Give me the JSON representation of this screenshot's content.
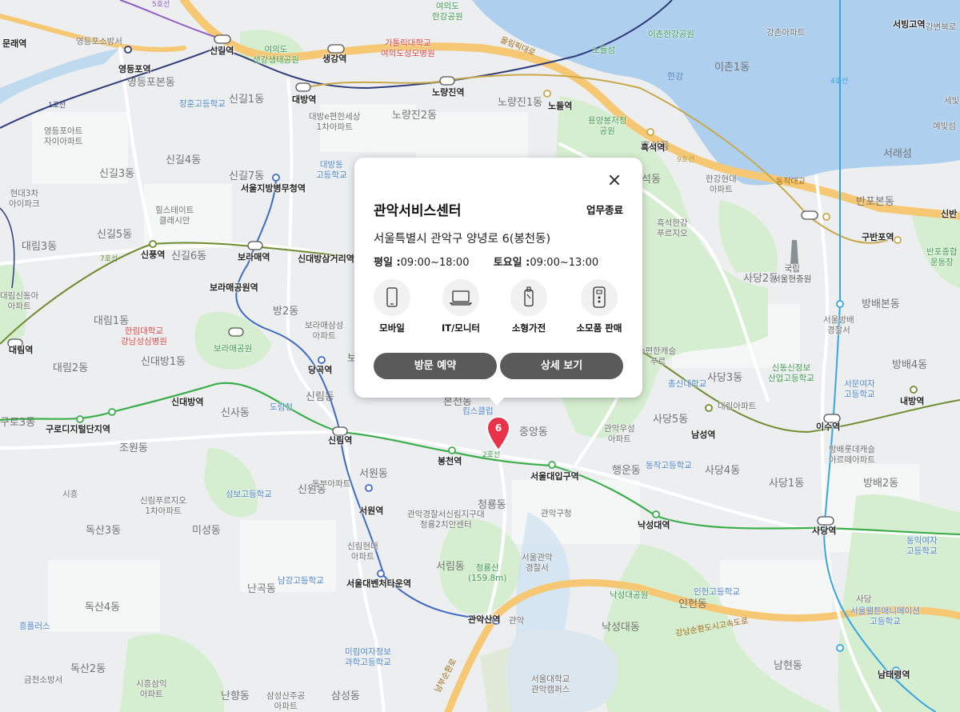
{
  "popup": {
    "title": "관악서비스센터",
    "status": "업무종료",
    "address": "서울특별시 관악구 양녕로 6(봉천동)",
    "weekday_label": "평일 :",
    "weekday_hours": "09:00~18:00",
    "saturday_label": "토요일 :",
    "saturday_hours": "09:00~13:00",
    "services": [
      {
        "label": "모바일",
        "icon": "mobile-icon"
      },
      {
        "label": "IT/모니터",
        "icon": "laptop-icon"
      },
      {
        "label": "소형가전",
        "icon": "small-appliance-icon"
      },
      {
        "label": "소모품 판매",
        "icon": "consumables-icon"
      }
    ],
    "visit_button": "방문 예약",
    "detail_button": "상세 보기"
  },
  "marker": {
    "number": "6",
    "color": "#e8334a"
  },
  "colors": {
    "river": "#aed0ee",
    "park": "#d6eed0",
    "line2": "#3cae4c",
    "line9": "#b8a04a",
    "road": "#f6c874"
  },
  "map": {
    "districts": [
      {
        "text": "영등포본동"
      },
      {
        "text": "신길1동"
      },
      {
        "text": "신길4동"
      },
      {
        "text": "신길3동"
      },
      {
        "text": "신길7동"
      },
      {
        "text": "신길5동"
      },
      {
        "text": "신길6동"
      },
      {
        "text": "대림3동"
      },
      {
        "text": "대림1동"
      },
      {
        "text": "대림2동"
      },
      {
        "text": "신대방1동"
      },
      {
        "text": "신사동"
      },
      {
        "text": "신림동"
      },
      {
        "text": "서원동"
      },
      {
        "text": "신원동"
      },
      {
        "text": "조원동"
      },
      {
        "text": "미성동"
      },
      {
        "text": "독산3동"
      },
      {
        "text": "독산4동"
      },
      {
        "text": "독산2동"
      },
      {
        "text": "난곡동"
      },
      {
        "text": "난향동"
      },
      {
        "text": "삼성동"
      },
      {
        "text": "서림동"
      },
      {
        "text": "청룡동"
      },
      {
        "text": "중앙동"
      },
      {
        "text": "행운동"
      },
      {
        "text": "낙성대동"
      },
      {
        "text": "인헌동"
      },
      {
        "text": "남현동"
      },
      {
        "text": "사당5동"
      },
      {
        "text": "사당4동"
      },
      {
        "text": "사당3동"
      },
      {
        "text": "사당1동"
      },
      {
        "text": "사당2동"
      },
      {
        "text": "방배본동"
      },
      {
        "text": "방배4동"
      },
      {
        "text": "방배2동"
      },
      {
        "text": "반포본동"
      },
      {
        "text": "서래섬"
      },
      {
        "text": "이촌1동"
      },
      {
        "text": "노량진1동"
      },
      {
        "text": "노량진2동"
      },
      {
        "text": "흑석동"
      },
      {
        "text": "석동"
      },
      {
        "text": "보"
      },
      {
        "text": "구로3동"
      },
      {
        "text": "방2동"
      },
      {
        "text": "본천동"
      }
    ],
    "stations": [
      {
        "text": "문래역"
      },
      {
        "text": "영등포역"
      },
      {
        "text": "신길역"
      },
      {
        "text": "생강역"
      },
      {
        "text": "대방역"
      },
      {
        "text": "노량진역"
      },
      {
        "text": "노들역"
      },
      {
        "text": "흑석역"
      },
      {
        "text": "서울지방병무청역"
      },
      {
        "text": "신풍역"
      },
      {
        "text": "보라매역"
      },
      {
        "text": "신대방삼거리역"
      },
      {
        "text": "보라매공원역"
      },
      {
        "text": "대림역"
      },
      {
        "text": "당곡역"
      },
      {
        "text": "신대방역"
      },
      {
        "text": "구로디지털단지역"
      },
      {
        "text": "신림역"
      },
      {
        "text": "봉천역"
      },
      {
        "text": "서울대입구역"
      },
      {
        "text": "서원역"
      },
      {
        "text": "낙성대역"
      },
      {
        "text": "서울대벤처타운역"
      },
      {
        "text": "관악산역"
      },
      {
        "text": "남성역"
      },
      {
        "text": "이수역"
      },
      {
        "text": "내방역"
      },
      {
        "text": "사당역"
      },
      {
        "text": "구반포역"
      },
      {
        "text": "남태령역"
      },
      {
        "text": "서빙고역"
      },
      {
        "text": "신반"
      }
    ],
    "pois": [
      {
        "text": "영등포소방서"
      },
      {
        "text": "장훈고등학교"
      },
      {
        "text": "영등포아트\n자이아파트"
      },
      {
        "text": "현대3차\n아이파크"
      },
      {
        "text": "힐스테이트\n클래시안"
      },
      {
        "text": "대림신동아\n아파트"
      },
      {
        "text": "한림대학교\n강남성심병원"
      },
      {
        "text": "보라매삼성\n아파트"
      },
      {
        "text": "보라매공원"
      },
      {
        "text": "대방e편한세상\n1차아파트"
      },
      {
        "text": "대방동\n고등학교"
      },
      {
        "text": "여의도\n샛강생태공원"
      },
      {
        "text": "가톨릭대학교\n여의도성모병원"
      },
      {
        "text": "여의도\n한강공원"
      },
      {
        "text": "이촌한강공원"
      },
      {
        "text": "노들섬"
      },
      {
        "text": "용양봉저정\n공원"
      },
      {
        "text": "강촌아파트"
      },
      {
        "text": "한강현대\n아파트"
      },
      {
        "text": "흑석한강\n푸르지오"
      },
      {
        "text": "국립\n서울현충원"
      },
      {
        "text": "반포종합\n운동장"
      },
      {
        "text": "서울방배\n경찰서"
      },
      {
        "text": "신동신정보\n산업고등학교"
      },
      {
        "text": "서문여자\n고등학교"
      },
      {
        "text": "대림아파트"
      },
      {
        "text": "총신대학교"
      },
      {
        "text": "e편한캐슬\n푸르"
      },
      {
        "text": "관악우성\n아파트"
      },
      {
        "text": "동작고등학교"
      },
      {
        "text": "방배롯데캐슬\n아르떼아파트"
      },
      {
        "text": "동익여자\n고등학교"
      },
      {
        "text": "서울웰튼애니메이션\n고등학교"
      },
      {
        "text": "인헌고등학교"
      },
      {
        "text": "낙성대공원"
      },
      {
        "text": "관악구청"
      },
      {
        "text": "관악경찰서신림지구대\n청룡2치안센터"
      },
      {
        "text": "서울관악\n경찰서"
      },
      {
        "text": "청룡산\n(159.8m)"
      },
      {
        "text": "신림현대\n아파트"
      },
      {
        "text": "남강고등학교"
      },
      {
        "text": "미림여자정보\n과학고등학교"
      },
      {
        "text": "서울대학교\n관악캠퍼스"
      },
      {
        "text": "성보고등학교"
      },
      {
        "text": "신림푸르지오\n1차아파트"
      },
      {
        "text": "동부아파트"
      },
      {
        "text": "흥플러스"
      },
      {
        "text": "금천소방서"
      },
      {
        "text": "시흥삼익\n아파트"
      },
      {
        "text": "삼성산주공\n아파트"
      },
      {
        "text": "킴스클럽"
      },
      {
        "text": "한강"
      },
      {
        "text": "예빛섬"
      },
      {
        "text": "세빛"
      },
      {
        "text": "강변북로"
      },
      {
        "text": "도림천"
      },
      {
        "text": "시흥"
      },
      {
        "text": "관악"
      },
      {
        "text": "사당"
      }
    ],
    "roads": [
      {
        "text": "올림픽대로"
      },
      {
        "text": "강남순환도시고속도로"
      },
      {
        "text": "동작대교"
      },
      {
        "text": "남부순환로"
      }
    ],
    "line_tags": [
      {
        "text": "2호선"
      },
      {
        "text": "7호선"
      },
      {
        "text": "9호선"
      },
      {
        "text": "4호선"
      },
      {
        "text": "5호선"
      },
      {
        "text": "1호선"
      }
    ]
  }
}
